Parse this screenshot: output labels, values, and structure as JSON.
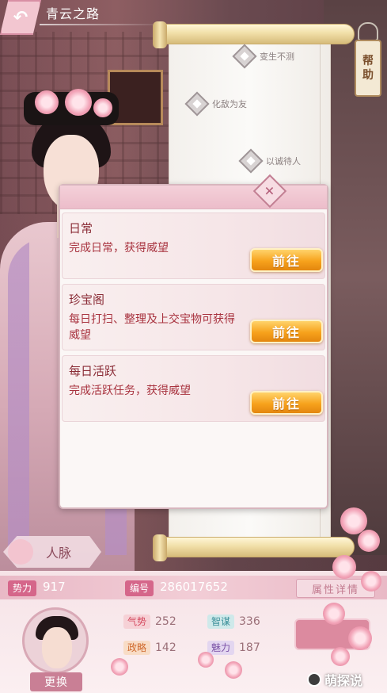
{
  "header": {
    "title": "青云之路",
    "back_icon": "back-arrow-icon"
  },
  "help": {
    "label_top": "帮",
    "label_bottom": "助"
  },
  "scroll": {
    "nodes": [
      {
        "label": "变生不测"
      },
      {
        "label": "化敌为友"
      },
      {
        "label": "以诚待人"
      }
    ]
  },
  "tasks": [
    {
      "title": "日常",
      "desc": "完成日常，获得威望",
      "button": "前往"
    },
    {
      "title": "珍宝阁",
      "desc": "每日打扫、整理及上交宝物可获得威望",
      "button": "前往"
    },
    {
      "title": "每日活跃",
      "desc": "完成活跃任务，获得威望",
      "button": "前往"
    }
  ],
  "relations": {
    "label": "人脉"
  },
  "stats": {
    "power_label": "势力",
    "power_value": "917",
    "id_label": "编号",
    "id_value": "286017652",
    "attr_button": "属性详情"
  },
  "attributes": [
    {
      "label": "气势",
      "value": "252"
    },
    {
      "label": "智谋",
      "value": "336"
    },
    {
      "label": "政略",
      "value": "142"
    },
    {
      "label": "魅力",
      "value": "187"
    }
  ],
  "avatar": {
    "change_label": "更换"
  },
  "watermark": {
    "text": "萌探说"
  },
  "colors": {
    "accent_pink": "#d5668a",
    "button_gold": "#f7a21c",
    "task_text": "#a8323e"
  }
}
